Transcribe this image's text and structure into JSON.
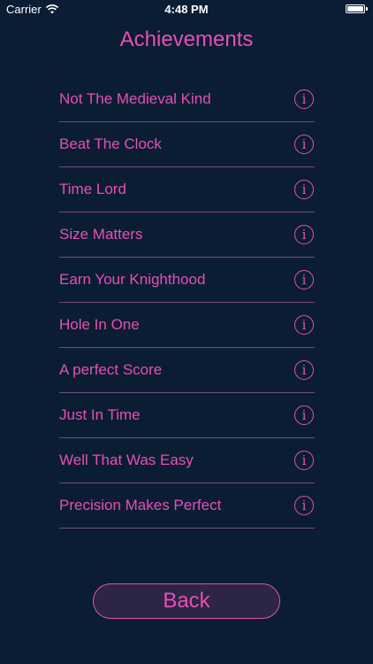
{
  "status_bar": {
    "carrier": "Carrier",
    "time": "4:48 PM",
    "wifi_icon": "wifi-icon",
    "battery_icon": "battery-icon",
    "battery_level": 1.0
  },
  "title": "Achievements",
  "achievements": [
    {
      "label": "Not The Medieval Kind",
      "icon": "info-icon"
    },
    {
      "label": "Beat The Clock",
      "icon": "info-icon"
    },
    {
      "label": "Time Lord",
      "icon": "info-icon"
    },
    {
      "label": "Size Matters",
      "icon": "info-icon"
    },
    {
      "label": "Earn Your Knighthood",
      "icon": "info-icon"
    },
    {
      "label": "Hole In One",
      "icon": "info-icon"
    },
    {
      "label": "A perfect Score",
      "icon": "info-icon"
    },
    {
      "label": "Just In Time",
      "icon": "info-icon"
    },
    {
      "label": "Well That Was Easy",
      "icon": "info-icon"
    },
    {
      "label": "Precision Makes Perfect",
      "icon": "info-icon"
    }
  ],
  "info_glyph": "i",
  "back_label": "Back",
  "colors": {
    "background": "#0b1d33",
    "accent": "#e64fb4",
    "divider": "#7a4a78",
    "button_fill": "#2c2545"
  }
}
